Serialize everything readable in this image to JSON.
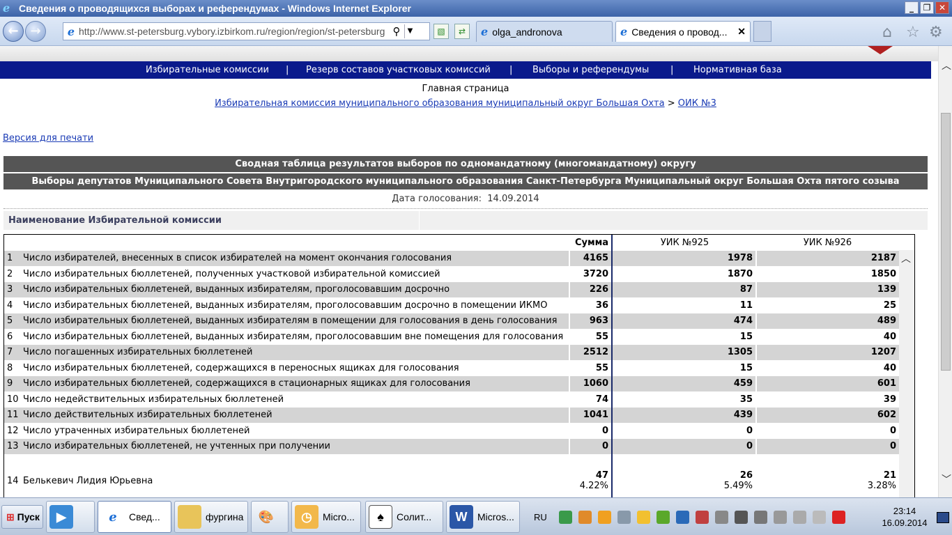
{
  "window": {
    "title": "Сведения о проводящихся выборах и референдумах - Windows Internet Explorer",
    "buttons": [
      "_",
      "❐",
      "✕"
    ]
  },
  "browser": {
    "url": "http://www.st-petersburg.vybory.izbirkom.ru/region/region/st-petersburg",
    "tabs": [
      {
        "label": "olga_andronova"
      },
      {
        "label": "Сведения о провод..."
      }
    ]
  },
  "site_menu": {
    "items": [
      "Избирательные комиссии",
      "Резерв составов участковых комиссий",
      "Выборы и референдумы",
      "Нормативная база"
    ],
    "separator": "|"
  },
  "breadcrumbs": {
    "main": "Главная страница",
    "link1": "Избирательная комиссия муниципального образования муниципальный округ Большая Охта",
    "sep": ">",
    "link2": "ОИК №3"
  },
  "print_link": "Версия для печати",
  "header1": "Сводная таблица результатов выборов по одномандатному (многомандатному) округу",
  "header2": "Выборы депутатов Муниципального Совета Внутригородского муниципального образования Санкт-Петербурга Муниципальный округ Большая Охта пятого созыва",
  "vote_date_label": "Дата голосования:",
  "vote_date": "14.09.2014",
  "commission_label": "Наименование Избирательной комиссии",
  "table": {
    "columns": {
      "sum": "Сумма",
      "uik1": "УИК №925",
      "uik2": "УИК №926"
    },
    "rows": [
      {
        "n": "1",
        "text": "Число избирателей, внесенных в список избирателей на момент окончания голосования",
        "sum": "4165",
        "v1": "1978",
        "v2": "2187"
      },
      {
        "n": "2",
        "text": "Число избирательных бюллетеней, полученных участковой избирательной комиссией",
        "sum": "3720",
        "v1": "1870",
        "v2": "1850"
      },
      {
        "n": "3",
        "text": "Число избирательных бюллетеней, выданных избирателям, проголосовавшим досрочно",
        "sum": "226",
        "v1": "87",
        "v2": "139"
      },
      {
        "n": "4",
        "text": "Число избирательных бюллетеней, выданных избирателям, проголосовавшим досрочно в помещении ИКМО",
        "sum": "36",
        "v1": "11",
        "v2": "25"
      },
      {
        "n": "5",
        "text": "Число избирательных бюллетеней, выданных избирателям в помещении для голосования в день голосования",
        "sum": "963",
        "v1": "474",
        "v2": "489"
      },
      {
        "n": "6",
        "text": "Число избирательных бюллетеней, выданных избирателям, проголосовавшим вне помещения для голосования",
        "sum": "55",
        "v1": "15",
        "v2": "40"
      },
      {
        "n": "7",
        "text": "Число погашенных избирательных бюллетеней",
        "sum": "2512",
        "v1": "1305",
        "v2": "1207"
      },
      {
        "n": "8",
        "text": "Число избирательных бюллетеней, содержащихся в переносных ящиках для голосования",
        "sum": "55",
        "v1": "15",
        "v2": "40"
      },
      {
        "n": "9",
        "text": "Число избирательных бюллетеней, содержащихся в стационарных ящиках для голосования",
        "sum": "1060",
        "v1": "459",
        "v2": "601"
      },
      {
        "n": "10",
        "text": "Число недействительных избирательных бюллетеней",
        "sum": "74",
        "v1": "35",
        "v2": "39"
      },
      {
        "n": "11",
        "text": "Число действительных избирательных бюллетеней",
        "sum": "1041",
        "v1": "439",
        "v2": "602"
      },
      {
        "n": "12",
        "text": "Число утраченных избирательных бюллетеней",
        "sum": "0",
        "v1": "0",
        "v2": "0"
      },
      {
        "n": "13",
        "text": "Число избирательных бюллетеней, не учтенных при получении",
        "sum": "0",
        "v1": "0",
        "v2": "0"
      }
    ],
    "candidate": {
      "n": "14",
      "name": "Белькевич Лидия Юрьевна",
      "sum": "47",
      "sum_pct": "4.22%",
      "v1": "26",
      "v1_pct": "5.49%",
      "v2": "21",
      "v2_pct": "3.28%"
    }
  },
  "taskbar": {
    "start": "Пуск",
    "items": [
      "Свед...",
      "фургина",
      "Micro...",
      "Солит...",
      "Micros..."
    ],
    "lang": "RU",
    "time": "23:14",
    "date": "16.09.2014"
  },
  "colors": {
    "menu_bg": "#0a1a8c",
    "header_bg": "#555555",
    "row_gray": "#d4d4d4",
    "link": "#1a3bb5"
  }
}
